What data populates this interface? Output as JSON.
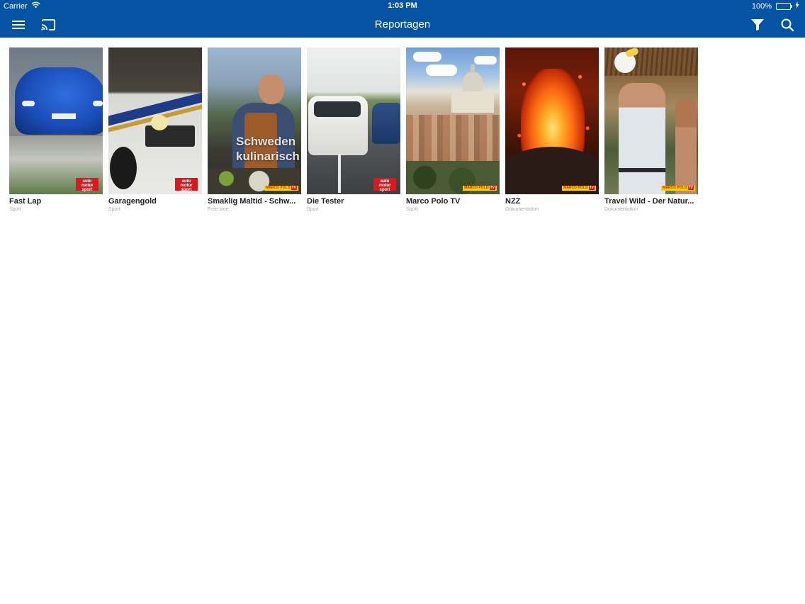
{
  "status_bar": {
    "carrier": "Carrier",
    "time": "1:03 PM",
    "battery": "100%",
    "battery_level": 1.0
  },
  "nav": {
    "title": "Reportagen",
    "menu_icon": "hamburger-menu-icon",
    "cast_icon": "cast-icon",
    "filter_icon": "filter-icon",
    "search_icon": "search-icon"
  },
  "colors": {
    "nav_background": "#0553a3",
    "text_primary": "#222222",
    "text_secondary": "#aaaaaa"
  },
  "items": [
    {
      "title": "Fast Lap",
      "category": "Sport",
      "badge": "auto motor sport"
    },
    {
      "title": "Garagengold",
      "category": "Sport",
      "badge": "auto motor sport"
    },
    {
      "title": "Smaklig Maltid - Schw...",
      "category": "Free time",
      "badge": "MARCO POLO TV",
      "overlay": [
        "Schweden",
        "kulinarisch"
      ]
    },
    {
      "title": "Die Tester",
      "category": "Sport",
      "badge": "auto motor sport"
    },
    {
      "title": "Marco Polo TV",
      "category": "Sport",
      "badge": "MARCO POLO TV"
    },
    {
      "title": "NZZ",
      "category": "Dokumentation",
      "badge": "MARCO POLO TV"
    },
    {
      "title": "Travel Wild - Der Natur...",
      "category": "Dokumentation",
      "badge": "MARCO POLO TV"
    }
  ]
}
